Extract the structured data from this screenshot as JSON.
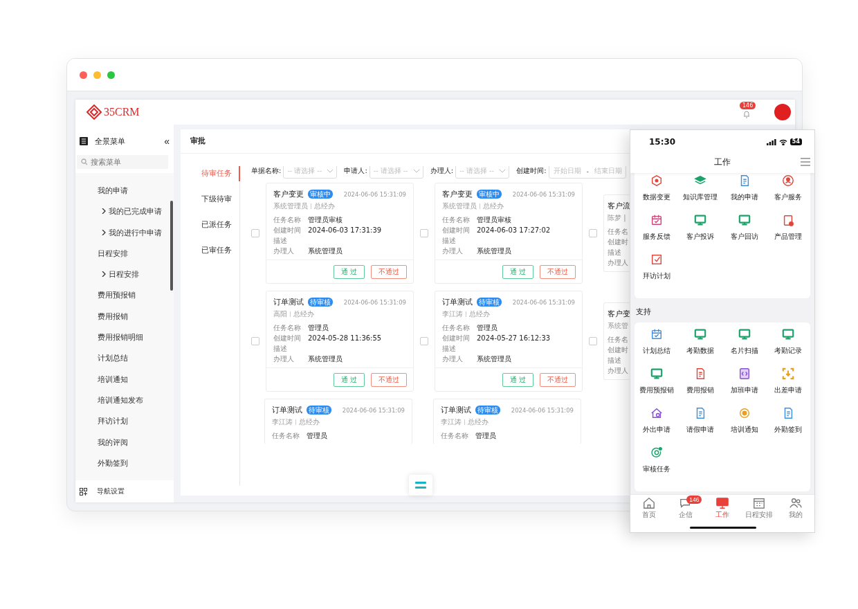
{
  "browser": {
    "logo": "35CRM",
    "notifications": "146",
    "sidebar": {
      "title": "全景菜单",
      "collapse": "«",
      "search": {
        "placeholder": "搜索菜单"
      },
      "items": [
        {
          "label": "我的申请",
          "children": [
            {
              "label": "我的已完成申请",
              "expanded": false
            },
            {
              "label": "我的进行中申请",
              "expanded": false
            }
          ]
        },
        {
          "label": "日程安排",
          "children": [
            {
              "label": "日程安排",
              "expanded": false
            }
          ]
        },
        {
          "label": "费用预报销"
        },
        {
          "label": "费用报销"
        },
        {
          "label": "费用报销明细"
        },
        {
          "label": "计划总结"
        },
        {
          "label": "培训通知"
        },
        {
          "label": "培训通知发布"
        },
        {
          "label": "拜访计划"
        },
        {
          "label": "我的评阅"
        },
        {
          "label": "外勤签到"
        }
      ],
      "footer": "导航设置"
    },
    "page_title": "审批",
    "tabs": [
      {
        "label": "待审任务",
        "selected": true
      },
      {
        "label": "下级待审",
        "selected": false
      },
      {
        "label": "已派任务",
        "selected": false
      },
      {
        "label": "已审任务",
        "selected": false
      }
    ],
    "filters": [
      {
        "label": "单据名称:",
        "placeholder": "-- 请选择 --"
      },
      {
        "label": "申请人:",
        "placeholder": "-- 请选择 --"
      },
      {
        "label": "办理人:",
        "placeholder": "-- 请选择 --"
      }
    ],
    "date_filter": {
      "label": "创建时间:",
      "start_placeholder": "开始日期",
      "separator": "-",
      "end_placeholder": "结束日期"
    },
    "cards": [
      {
        "kind": "full",
        "checked": false,
        "title": "客户变更",
        "status": "审核中",
        "time": "2024-06-06 15:31:09",
        "person": "系统管理员",
        "dept": "总经办",
        "fields": [
          {
            "label": "任务名称",
            "value": "管理员审核"
          },
          {
            "label": "创建时间",
            "value": "2024-06-03 17:31:39"
          },
          {
            "label": "描述"
          },
          {
            "label": "办理人",
            "value": "系统管理员"
          }
        ],
        "approve": "通 过",
        "reject": "不通过"
      },
      {
        "kind": "full",
        "checked": false,
        "title": "客户变更",
        "status": "审核中",
        "time": "2024-06-06 15:31:09",
        "person": "系统管理员",
        "dept": "总经办",
        "fields": [
          {
            "label": "任务名称",
            "value": "管理员审核"
          },
          {
            "label": "创建时间",
            "value": "2024-06-03 17:27:02"
          },
          {
            "label": "描述"
          },
          {
            "label": "办理人",
            "value": "系统管理员"
          }
        ],
        "approve": "通 过",
        "reject": "不通过"
      },
      {
        "kind": "cut",
        "checked": false,
        "title": "客户流",
        "person": "陈梦 |",
        "fields": [
          {
            "label": "任务名"
          },
          {
            "label": "创建时"
          },
          {
            "label": "描述"
          },
          {
            "label": "办理人"
          }
        ]
      },
      {
        "kind": "full",
        "checked": false,
        "title": "订单测试",
        "status": "待审核",
        "time": "2024-06-06 15:31:09",
        "person": "高阳",
        "dept": "总经办",
        "fields": [
          {
            "label": "任务名称",
            "value": "管理员"
          },
          {
            "label": "创建时间",
            "value": "2024-05-28 11:36:55"
          },
          {
            "label": "描述"
          },
          {
            "label": "办理人",
            "value": "系统管理员"
          }
        ],
        "approve": "通 过",
        "reject": "不通过"
      },
      {
        "kind": "full",
        "checked": false,
        "title": "订单测试",
        "status": "待审核",
        "time": "2024-06-06 15:31:09",
        "person": "李江涛",
        "dept": "总经办",
        "fields": [
          {
            "label": "任务名称",
            "value": "管理员"
          },
          {
            "label": "创建时间",
            "value": "2024-05-27 16:12:33"
          },
          {
            "label": "描述"
          },
          {
            "label": "办理人",
            "value": "系统管理员"
          }
        ],
        "approve": "通 过",
        "reject": "不通过"
      },
      {
        "kind": "cut",
        "checked": false,
        "title": "客户变",
        "person": "系统管",
        "fields": [
          {
            "label": "任务名"
          },
          {
            "label": "创建时"
          },
          {
            "label": "描述"
          },
          {
            "label": "办理人"
          }
        ]
      },
      {
        "kind": "top",
        "title": "订单测试",
        "status": "待审核",
        "time": "2024-06-06 15:31:09",
        "person": "李江涛",
        "dept": "总经办",
        "fields": [
          {
            "label": "任务名称",
            "value": "管理员"
          }
        ]
      },
      {
        "kind": "top",
        "title": "订单测试",
        "status": "待审核",
        "time": "2024-06-06 15:31:09",
        "person": "李江涛",
        "dept": "总经办",
        "fields": [
          {
            "label": "任务名称",
            "value": "管理员"
          }
        ]
      }
    ]
  },
  "phone": {
    "time": "15:30",
    "battery": "54",
    "title": "工作",
    "top_items": [
      {
        "label": "数据变更",
        "kind": "cube",
        "color": "#e0463c"
      },
      {
        "label": "知识库管理",
        "kind": "layers",
        "color": "#1aa36a"
      },
      {
        "label": "我的申请",
        "kind": "doc",
        "color": "#3d8fe0"
      },
      {
        "label": "客户服务",
        "kind": "person",
        "color": "#e0463c"
      },
      {
        "label": "服务反馈",
        "kind": "calendar",
        "color": "#d0467a"
      },
      {
        "label": "客户投诉",
        "kind": "monitor",
        "color": "#1aa36a"
      },
      {
        "label": "客户回访",
        "kind": "monitor",
        "color": "#1aa36a"
      },
      {
        "label": "产品管理",
        "kind": "clipboard",
        "color": "#e0463c"
      },
      {
        "label": "拜访计划",
        "kind": "check",
        "color": "#e0463c"
      }
    ],
    "section": "支持",
    "support_items": [
      {
        "label": "计划总结",
        "kind": "calendar",
        "color": "#3d8fe0"
      },
      {
        "label": "考勤数据",
        "kind": "monitor",
        "color": "#1aa36a"
      },
      {
        "label": "名片扫描",
        "kind": "monitor",
        "color": "#1aa36a"
      },
      {
        "label": "考勤记录",
        "kind": "monitor",
        "color": "#1aa36a"
      },
      {
        "label": "费用预报销",
        "kind": "monitor",
        "color": "#1aa36a"
      },
      {
        "label": "费用报销",
        "kind": "doc",
        "color": "#e0463c"
      },
      {
        "label": "加班申请",
        "kind": "code",
        "color": "#8a4fd8"
      },
      {
        "label": "出差申请",
        "kind": "scan",
        "color": "#e8a020"
      },
      {
        "label": "外出申请",
        "kind": "house",
        "color": "#8a4fd8"
      },
      {
        "label": "请假申请",
        "kind": "doc",
        "color": "#3d8fe0"
      },
      {
        "label": "培训通知",
        "kind": "circle",
        "color": "#e8a020"
      },
      {
        "label": "外勤签到",
        "kind": "doc",
        "color": "#3d8fe0"
      },
      {
        "label": "审核任务",
        "kind": "target",
        "color": "#1aa36a"
      }
    ],
    "tabbar": [
      {
        "label": "首页",
        "kind": "home",
        "selected": false
      },
      {
        "label": "企信",
        "kind": "chat",
        "badge": "146",
        "selected": false
      },
      {
        "label": "工作",
        "kind": "monitor",
        "selected": true
      },
      {
        "label": "日程安排",
        "kind": "calendar",
        "selected": false
      },
      {
        "label": "我的",
        "kind": "people",
        "selected": false
      }
    ]
  }
}
